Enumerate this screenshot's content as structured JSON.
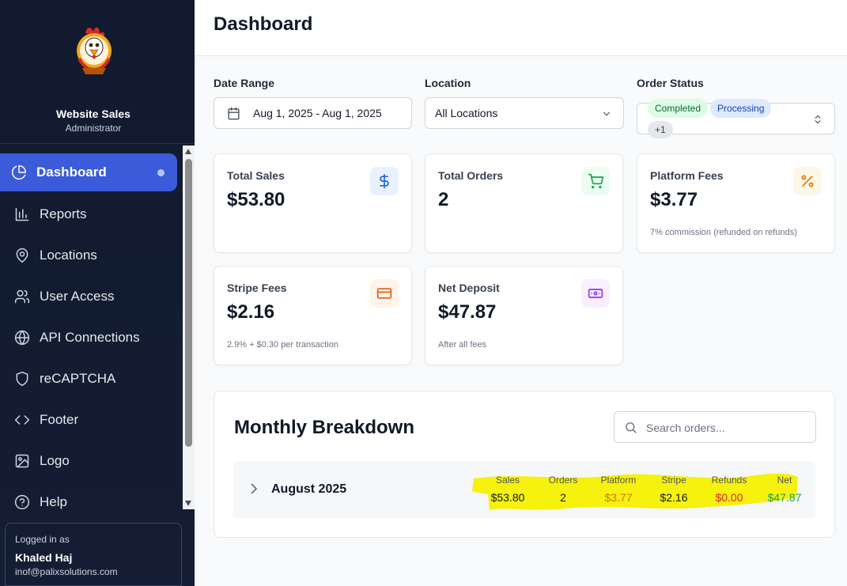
{
  "sidebar": {
    "brand_name": "Website Sales",
    "brand_role": "Administrator",
    "items": [
      {
        "label": "Dashboard",
        "icon": "pie-chart-icon",
        "active": true
      },
      {
        "label": "Reports",
        "icon": "bar-chart-icon"
      },
      {
        "label": "Locations",
        "icon": "map-pin-icon"
      },
      {
        "label": "User Access",
        "icon": "users-icon"
      },
      {
        "label": "API Connections",
        "icon": "globe-icon"
      },
      {
        "label": "reCAPTCHA",
        "icon": "shield-icon"
      },
      {
        "label": "Footer",
        "icon": "code-icon"
      },
      {
        "label": "Logo",
        "icon": "image-icon"
      },
      {
        "label": "Help",
        "icon": "help-circle-icon"
      }
    ],
    "user": {
      "caption": "Logged in as",
      "name": "Khaled Haj",
      "email": "inof@palixsolutions.com"
    }
  },
  "header": {
    "title": "Dashboard"
  },
  "filters": {
    "date_range": {
      "label": "Date Range",
      "value": "Aug 1, 2025 - Aug 1, 2025"
    },
    "location": {
      "label": "Location",
      "value": "All Locations"
    },
    "order_status": {
      "label": "Order Status",
      "chips": [
        "Completed",
        "Processing",
        "+1"
      ]
    }
  },
  "cards": [
    {
      "label": "Total Sales",
      "value": "$53.80",
      "note": "",
      "icon": "dollar-icon",
      "accent": "#2563eb",
      "bg": "#eff6ff"
    },
    {
      "label": "Total Orders",
      "value": "2",
      "note": "",
      "icon": "cart-icon",
      "accent": "#16a34a",
      "bg": "#f0fdf4"
    },
    {
      "label": "Platform Fees",
      "value": "$3.77",
      "note": "7% commission (refunded on refunds)",
      "icon": "percent-icon",
      "accent": "#d97706",
      "bg": "#fffbeb"
    },
    {
      "label": "Stripe Fees",
      "value": "$2.16",
      "note": "2.9% + $0.30 per transaction",
      "icon": "credit-card-icon",
      "accent": "#ea580c",
      "bg": "#fff7ed"
    },
    {
      "label": "Net Deposit",
      "value": "$47.87",
      "note": "After all fees",
      "icon": "banknote-icon",
      "accent": "#9333ea",
      "bg": "#faf5ff"
    }
  ],
  "breakdown": {
    "title": "Monthly Breakdown",
    "search_placeholder": "Search orders...",
    "month": "August 2025",
    "stats": [
      {
        "label": "Sales",
        "value": "$53.80",
        "color": "#111827"
      },
      {
        "label": "Orders",
        "value": "2",
        "color": "#111827"
      },
      {
        "label": "Platform",
        "value": "$3.77",
        "color": "#d97706"
      },
      {
        "label": "Stripe",
        "value": "$2.16",
        "color": "#111827"
      },
      {
        "label": "Refunds",
        "value": "$0.00",
        "color": "#dc2626"
      },
      {
        "label": "Net",
        "value": "$47.87",
        "color": "#16a34a"
      }
    ],
    "highlight_color": "#f5f000"
  }
}
